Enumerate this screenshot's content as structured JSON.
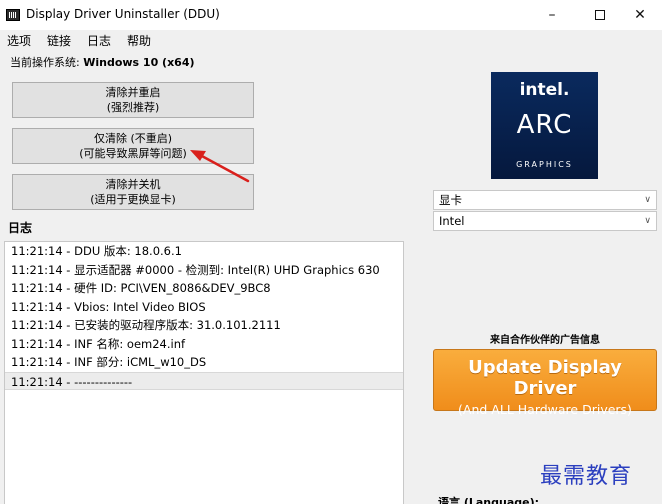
{
  "window": {
    "title": "Display Driver Uninstaller (DDU)",
    "minimize": "–",
    "close": "✕"
  },
  "menu": [
    "选项",
    "链接",
    "日志",
    "帮助"
  ],
  "os": {
    "label": "当前操作系统:",
    "value": "Windows 10 (x64)"
  },
  "actions": [
    {
      "line1": "清除并重启",
      "line2": "(强烈推荐)"
    },
    {
      "line1": "仅清除 (不重启)",
      "line2": "(可能导致黑屏等问题)"
    },
    {
      "line1": "清除并关机",
      "line2": "(适用于更换显卡)"
    }
  ],
  "log": {
    "label": "日志",
    "rows": [
      "11:21:14 - DDU 版本: 18.0.6.1",
      "11:21:14 - 显示适配器 #0000 - 检测到: Intel(R) UHD Graphics 630",
      "11:21:14 - 硬件 ID: PCI\\VEN_8086&DEV_9BC8",
      "11:21:14 - Vbios: Intel Video BIOS",
      "11:21:14 - 已安装的驱动程序版本: 31.0.101.2111",
      "11:21:14 - INF 名称: oem24.inf",
      "11:21:14 - INF 部分: iCML_w10_DS",
      "11:21:14 - --------------"
    ]
  },
  "logo": {
    "brand": "intel.",
    "product": "ARC",
    "sub": "GRAPHICS"
  },
  "device_type": {
    "selected": "显卡"
  },
  "vendor": {
    "selected": "Intel"
  },
  "ad": {
    "caption": "来自合作伙伴的广告信息",
    "line1": "Update Display Driver",
    "line2": "(And ALL Hardware Drivers)"
  },
  "watermark": "最需教育",
  "language_label": "语言 (Language):",
  "colors": {
    "accent_arrow": "#d9201c",
    "ad_orange": "#f5a030",
    "logo_navy": "#0a2a5e"
  }
}
